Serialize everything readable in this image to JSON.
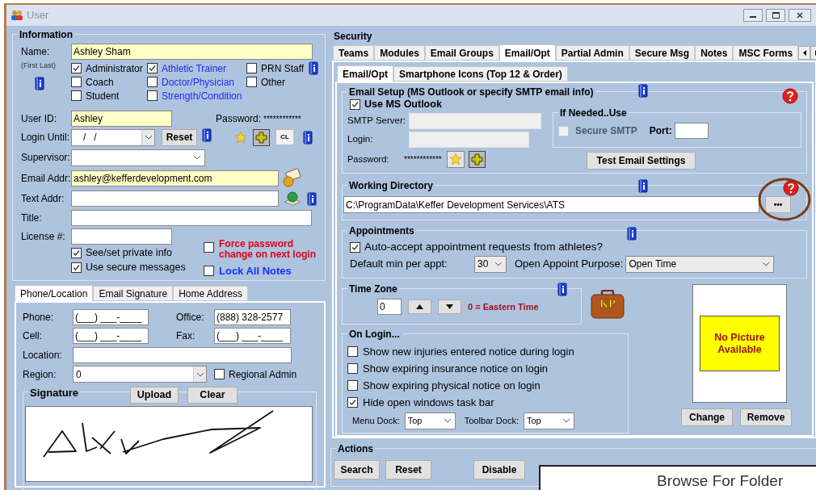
{
  "window": {
    "title": "User"
  },
  "information": {
    "title": "Information",
    "name": {
      "label": "Name:",
      "hint": "(First Last)",
      "value": "Ashley Sham"
    },
    "roles": [
      {
        "label": "Administrator",
        "checked": true,
        "kind": "general"
      },
      {
        "label": "Athletic Trainer",
        "checked": true,
        "kind": "medical"
      },
      {
        "label": "PRN Staff",
        "checked": false,
        "kind": "general"
      },
      {
        "label": "Coach",
        "checked": false,
        "kind": "general"
      },
      {
        "label": "Doctor/Physician",
        "checked": false,
        "kind": "medical"
      },
      {
        "label": "Other",
        "checked": false,
        "kind": "general"
      },
      {
        "label": "Student",
        "checked": false,
        "kind": "general"
      },
      {
        "label": "Strength/Condition",
        "checked": false,
        "kind": "medical"
      }
    ],
    "user_id": {
      "label": "User ID:",
      "value": "Ashley"
    },
    "password": {
      "label": "Password:",
      "value": "************"
    },
    "login_until": {
      "label": "Login Until:",
      "value": "/   /"
    },
    "reset_button": "Reset",
    "cl_button": "CL",
    "supervisor": {
      "label": "Supervisor:"
    },
    "email": {
      "label": "Email Addr:",
      "value": "ashley@kefferdevelopment.com"
    },
    "text_addr": {
      "label": "Text Addr:"
    },
    "title_field": {
      "label": "Title:"
    },
    "license": {
      "label": "License #:"
    },
    "options": [
      {
        "label": "See/set private info",
        "checked": true
      },
      {
        "label": "Use secure messages",
        "checked": true
      }
    ],
    "force_password": {
      "label": "Force password change on next login",
      "checked": false
    },
    "lock_notes": {
      "label": "Lock All Notes",
      "checked": false
    }
  },
  "contact_tabs": [
    {
      "label": "Phone/Location",
      "selected": true
    },
    {
      "label": "Email Signature",
      "selected": false
    },
    {
      "label": "Home Address",
      "selected": false
    }
  ],
  "contact": {
    "phone": {
      "label": "Phone:",
      "value": "(___) ___-____"
    },
    "office": {
      "label": "Office:",
      "value": "(888) 328-2577"
    },
    "cell": {
      "label": "Cell:",
      "value": "(___) ___-____"
    },
    "fax": {
      "label": "Fax:",
      "value": "(___) ___-____"
    },
    "location": {
      "label": "Location:"
    },
    "region": {
      "label": "Region:",
      "value": "0"
    },
    "regional_admin": {
      "label": "Regional Admin",
      "checked": false
    }
  },
  "signature": {
    "title": "Signature",
    "upload_button": "Upload",
    "clear_button": "Clear"
  },
  "security": {
    "title": "Security",
    "tabs": [
      {
        "label": "Teams",
        "selected": false
      },
      {
        "label": "Modules",
        "selected": false
      },
      {
        "label": "Email Groups",
        "selected": false
      },
      {
        "label": "Email/Opt",
        "selected": true
      },
      {
        "label": "Partial Admin",
        "selected": false
      },
      {
        "label": "Secure Msg",
        "selected": false
      },
      {
        "label": "Notes",
        "selected": false
      },
      {
        "label": "MSC Forms",
        "selected": false
      }
    ],
    "subtabs": [
      {
        "label": "Email/Opt",
        "selected": true
      },
      {
        "label": "Smartphone Icons (Top 12 & Order)",
        "selected": false
      }
    ],
    "email_setup": {
      "title": "Email Setup (MS Outlook or specify SMTP email info)",
      "use_outlook": {
        "label": "Use MS Outlook",
        "checked": true
      },
      "smtp_server": {
        "label": "SMTP Server:"
      },
      "login": {
        "label": "Login:"
      },
      "password": {
        "label": "Password:",
        "value": "************"
      },
      "if_needed": {
        "title": "If Needed..Use",
        "secure_smtp": {
          "label": "Secure SMTP",
          "checked": false,
          "disabled": true
        },
        "port": {
          "label": "Port:"
        }
      },
      "test_button": "Test Email Settings"
    },
    "working_directory": {
      "title": "Working Directory",
      "value": "C:\\ProgramData\\Keffer Development Services\\ATS",
      "browse_button": "•••"
    },
    "appointments": {
      "title": "Appointments",
      "auto_accept": {
        "label": "Auto-accept appointment requests from athletes?",
        "checked": true
      },
      "default_min": {
        "label": "Default min per appt:",
        "value": "30"
      },
      "purpose": {
        "label": "Open Appoint Purpose:",
        "value": "Open Time"
      }
    },
    "time_zone": {
      "title": "Time Zone",
      "value": "0",
      "note": "0 = Eastern Time"
    },
    "briefcase_label": "KP",
    "picture": {
      "message": "No Picture Available",
      "change_button": "Change",
      "remove_button": "Remove"
    },
    "on_login": {
      "title": "On Login...",
      "options": [
        {
          "label": "Show new injuries entered notice during login",
          "checked": false
        },
        {
          "label": "Show expiring insurance notice on login",
          "checked": false
        },
        {
          "label": "Show expiring physical notice on login",
          "checked": false
        },
        {
          "label": "Hide open windows task bar",
          "checked": true
        }
      ],
      "menu_dock": {
        "label": "Menu Dock:",
        "value": "Top"
      },
      "toolbar_dock": {
        "label": "Toolbar Dock:",
        "value": "Top"
      }
    }
  },
  "actions": {
    "title": "Actions",
    "buttons": [
      "Search",
      "Reset",
      "Disable"
    ]
  },
  "dialog": {
    "title": "Browse For Folder"
  }
}
